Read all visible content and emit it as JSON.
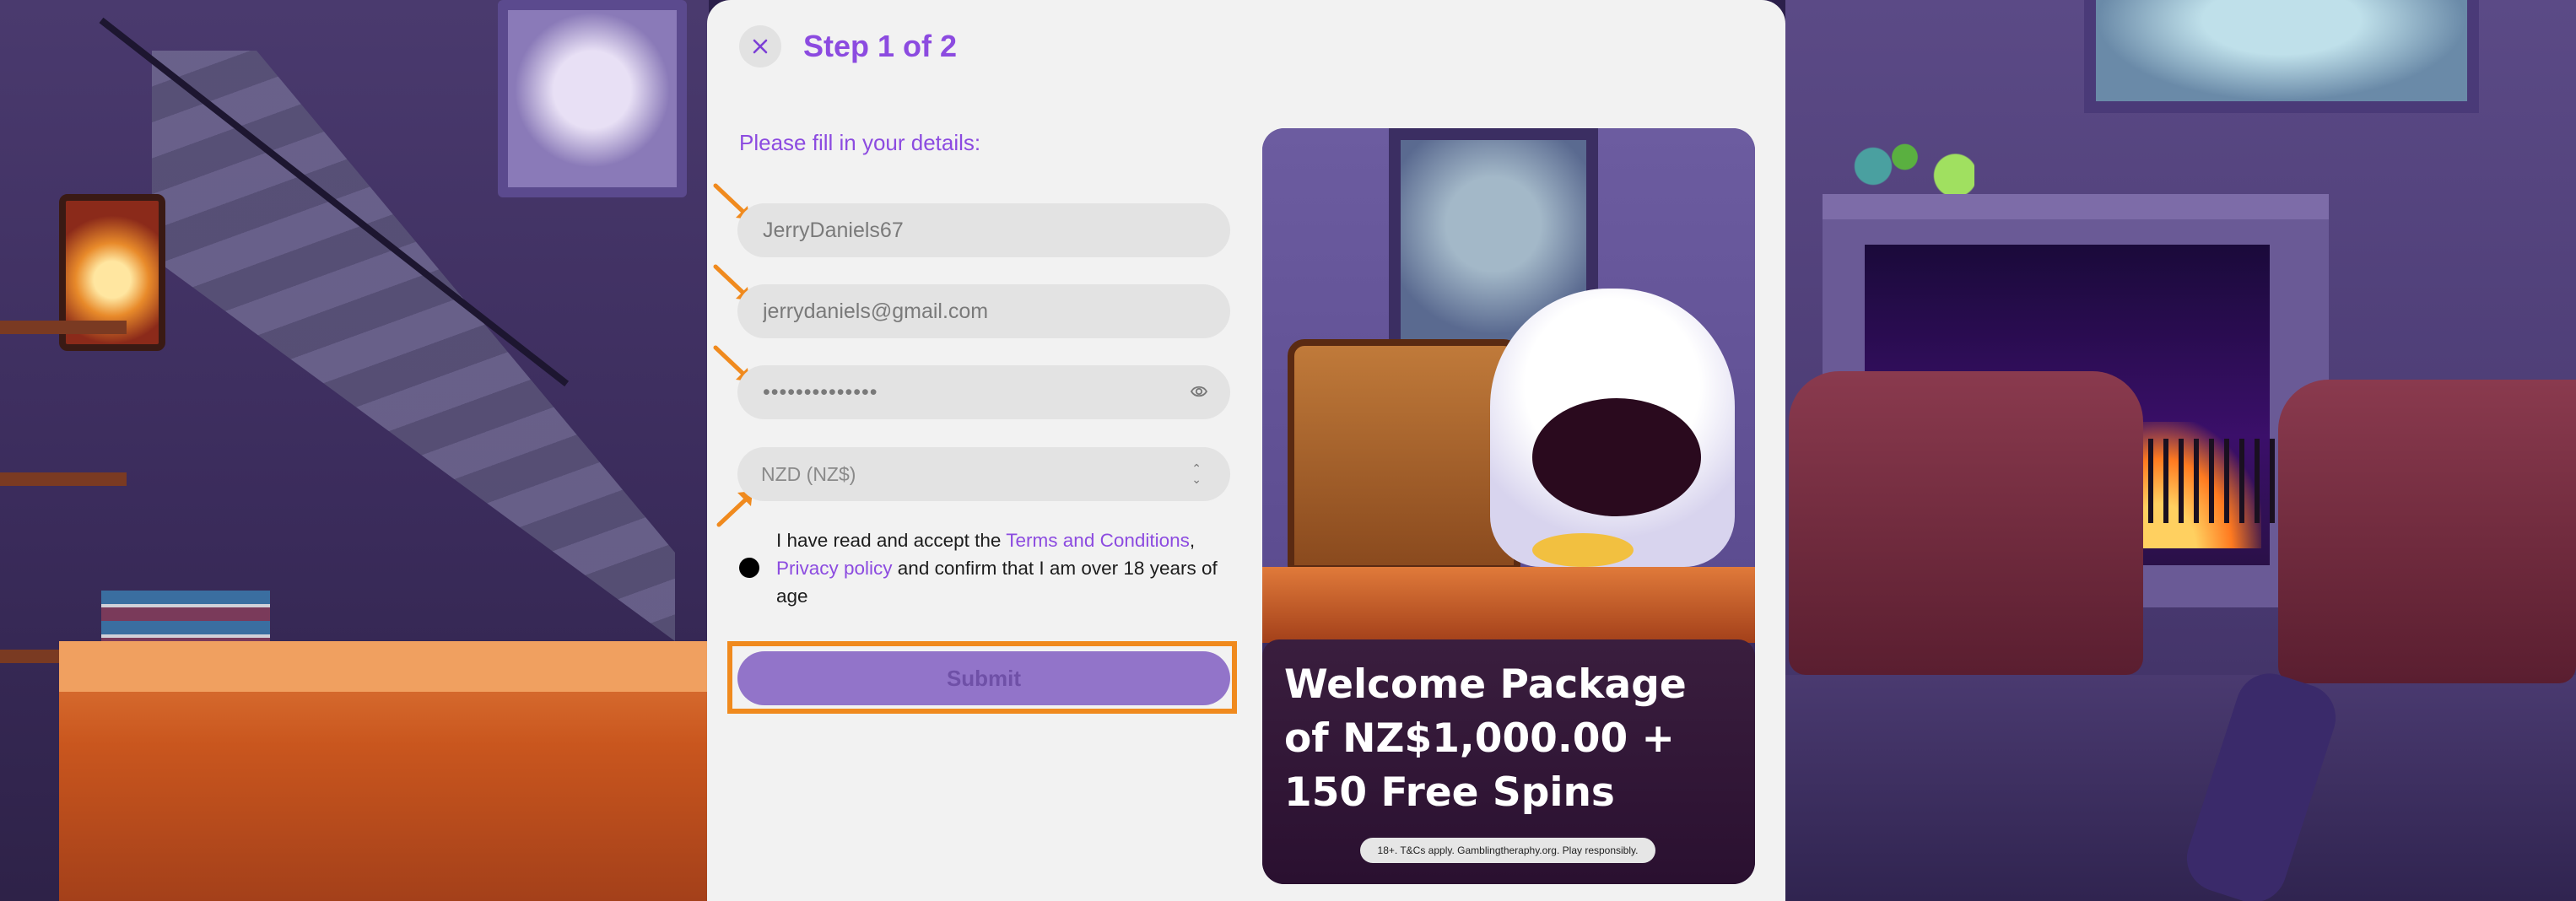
{
  "modal": {
    "close_icon": "close-icon",
    "step_title": "Step 1 of 2",
    "subtitle": "Please fill in your details:",
    "fields": {
      "username": {
        "value": "JerryDaniels67"
      },
      "email": {
        "value": "jerrydaniels@gmail.com"
      },
      "password": {
        "value": "••••••••••••••",
        "icon": "eye-icon"
      },
      "currency": {
        "value": "NZD (NZ$)",
        "icon": "chevron-updown-icon"
      }
    },
    "terms": {
      "text_1": "I have read and accept the ",
      "link_terms": "Terms and Conditions",
      "comma": ",",
      "link_privacy": "Privacy policy",
      "text_2": " and confirm that I am over 18 years of age"
    },
    "submit_label": "Submit"
  },
  "promo": {
    "title": "Welcome Package of NZ$1,000.00 + 150 Free Spins",
    "disclaimer": "18+. T&Cs apply. Gamblingtheraphy.org. Play responsibly."
  },
  "colors": {
    "accent": "#8c4be0",
    "highlight": "#f08a1e",
    "submit_bg": "#9274c9"
  }
}
